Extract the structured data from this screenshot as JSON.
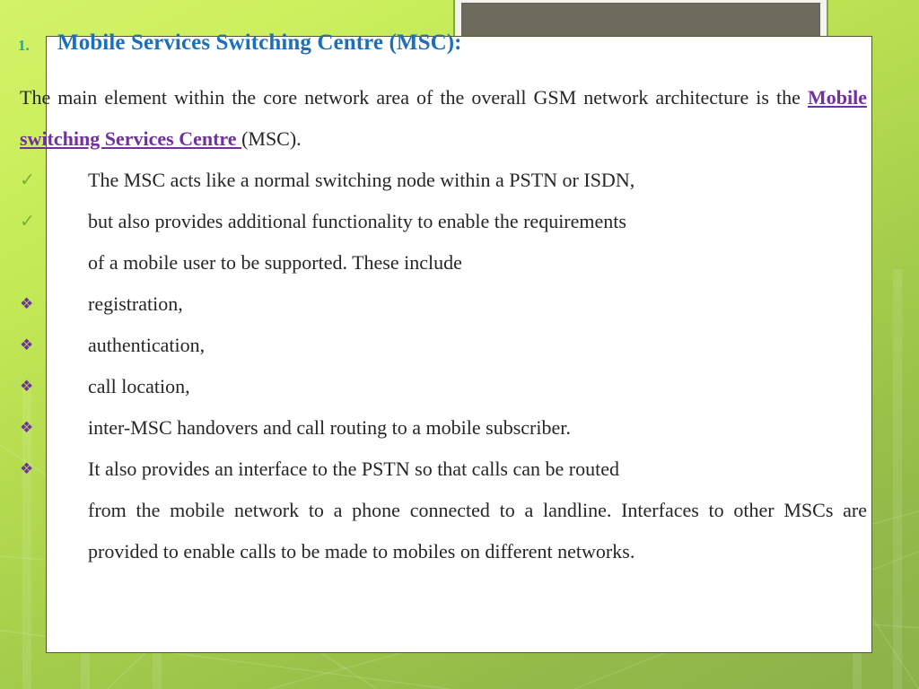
{
  "slide": {
    "heading": {
      "number": "1.",
      "title": "Mobile Services Switching Centre (MSC):"
    },
    "lead_paragraph": {
      "before": " The main element within the core network area of the overall GSM network architecture is the ",
      "emphasis": "Mobile switching Services Centre ",
      "after": "(MSC)."
    },
    "bullets": [
      {
        "marker": "check",
        "glyph": "✓",
        "text": "The MSC acts like a normal switching node within a PSTN or ISDN,"
      },
      {
        "marker": "check",
        "glyph": "✓",
        "text": "but also provides additional functionality to enable the requirements",
        "continuation": "of a mobile user to be supported. These include"
      },
      {
        "marker": "diamond",
        "glyph": "❖",
        "text": " registration,"
      },
      {
        "marker": "diamond",
        "glyph": "❖",
        "text": " authentication,"
      },
      {
        "marker": "diamond",
        "glyph": "❖",
        "text": "call location,"
      },
      {
        "marker": "diamond",
        "glyph": "❖",
        "text": "inter-MSC handovers and call routing to a mobile subscriber."
      },
      {
        "marker": "diamond",
        "glyph": "❖",
        "text": " It also provides an interface to the PSTN so that calls can be routed",
        "continuation": "from  the  mobile  network  to  a  phone  connected  to  a  landline. Interfaces to other MSCs are provided to enable calls to be made to mobiles on different networks."
      }
    ],
    "picture_placeholder": {
      "name": "picture-placeholder",
      "fill_color": "#6e6a5d",
      "frame_color": "#f4f3ee",
      "outline_color": "#7fa83c"
    },
    "colors": {
      "heading_blue": "#1f6fb8",
      "number_teal": "#1fa5b8",
      "emphasis_purple": "#7030a0",
      "check_green": "#7db02e",
      "panel_white": "#ffffff",
      "background_light_green": "#d2f268",
      "background_dark_green": "#8bb24a"
    }
  }
}
